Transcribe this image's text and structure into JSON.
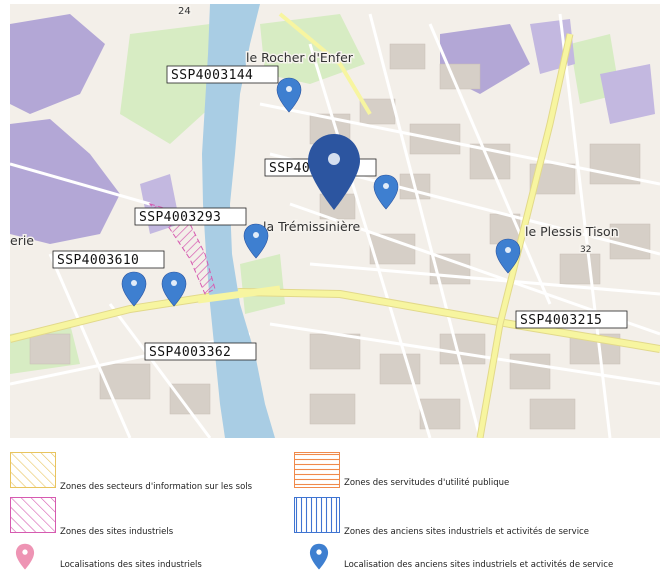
{
  "colors": {
    "water": "#a9cde4",
    "land": "#f3efe9",
    "road_major": "#f7f5a0",
    "road_minor": "#ffffff",
    "building": "#d6cfc7",
    "industrial": "#b3a7d6",
    "park": "#d7ecc3",
    "pin_main": "#2c55a0",
    "pin_small": "#3e7fd0",
    "pin_industrial": "#ee94b4",
    "hatch_yellow": "#e8c45e",
    "hatch_orange": "#f08a4b",
    "hatch_pink": "#d65bb0",
    "hatch_blue": "#3f74d1"
  },
  "map": {
    "place_labels": [
      {
        "id": "rocher",
        "text": "le Rocher d'Enfer"
      },
      {
        "id": "tremissiniere",
        "text": "la Trémissinière"
      },
      {
        "id": "plessis",
        "text": "le Plessis Tison"
      },
      {
        "id": "erie",
        "text": "erie"
      },
      {
        "id": "num24",
        "text": "24"
      },
      {
        "id": "num32",
        "text": "32"
      }
    ],
    "site_labels": [
      {
        "id": "s3144",
        "text": "SSP4003144"
      },
      {
        "id": "s3360",
        "text": "SSP4003360"
      },
      {
        "id": "s3293",
        "text": "SSP4003293"
      },
      {
        "id": "s3610",
        "text": "SSP4003610"
      },
      {
        "id": "s3215",
        "text": "SSP4003215"
      },
      {
        "id": "s3362",
        "text": "SSP4003362"
      }
    ],
    "markers": [
      {
        "id": "main",
        "icon": "map-pin-icon",
        "kind": "selected"
      },
      {
        "id": "m1",
        "icon": "map-pin-icon",
        "kind": "ancien-site"
      },
      {
        "id": "m2",
        "icon": "map-pin-icon",
        "kind": "ancien-site"
      },
      {
        "id": "m3",
        "icon": "map-pin-icon",
        "kind": "ancien-site"
      },
      {
        "id": "m4",
        "icon": "map-pin-icon",
        "kind": "ancien-site"
      },
      {
        "id": "m5",
        "icon": "map-pin-icon",
        "kind": "ancien-site"
      },
      {
        "id": "m6",
        "icon": "map-pin-icon",
        "kind": "ancien-site"
      }
    ]
  },
  "legend": {
    "items": [
      {
        "id": "sis",
        "swatch": "hatch-yellow",
        "label": "Zones des secteurs d'information sur les sols"
      },
      {
        "id": "sup",
        "swatch": "hatch-orange",
        "label": "Zones des servitudes d'utilité publique"
      },
      {
        "id": "industrial_zones",
        "swatch": "hatch-pink",
        "label": "Zones des sites industriels"
      },
      {
        "id": "old_industrial_zones",
        "swatch": "hatch-blue",
        "label": "Zones des anciens sites industriels et activités de service"
      },
      {
        "id": "industrial_points",
        "swatch": "pin-pink",
        "label": "Localisations des sites industriels"
      },
      {
        "id": "old_industrial_points",
        "swatch": "pin-blue",
        "label": "Localisation des anciens sites industriels et activités de service"
      }
    ]
  }
}
